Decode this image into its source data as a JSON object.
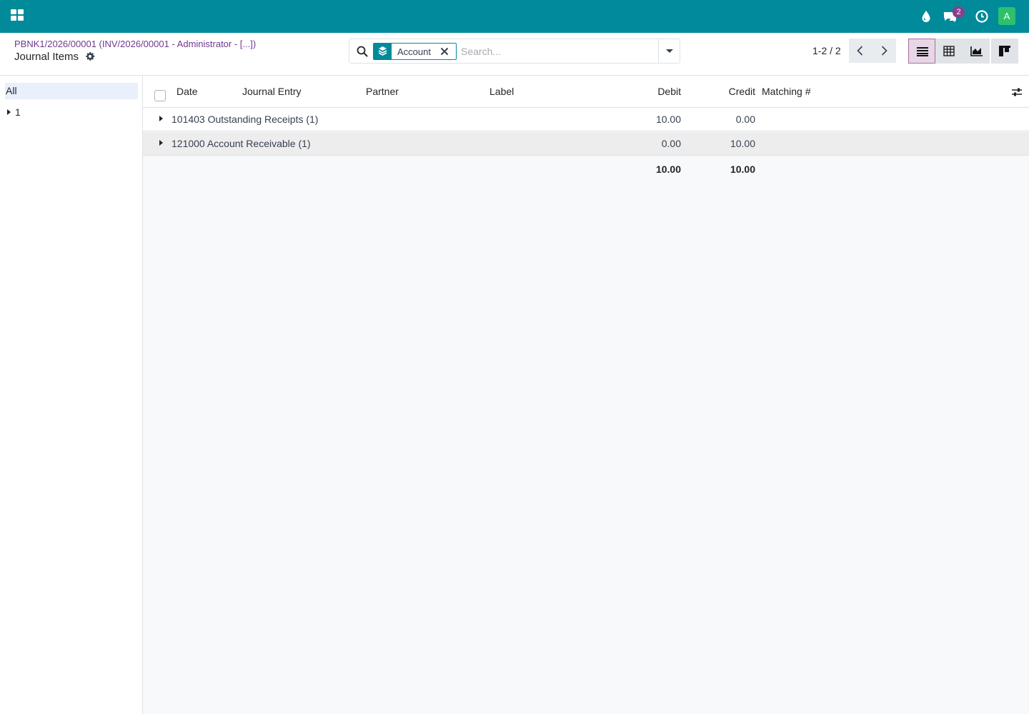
{
  "navbar": {
    "brand_color": "#018a9a",
    "icons": [
      "apps-icon",
      "water-drop-icon",
      "chat-icon",
      "clock-icon"
    ],
    "chat_count": "2",
    "avatar_letter": "A"
  },
  "control_panel": {
    "breadcrumb": "PBNK1/2026/00001 (INV/2026/00001 - Administrator - [...])",
    "title": "Journal Items",
    "search": {
      "facet_label": "Account",
      "placeholder": "Search..."
    },
    "pager": "1-2 / 2",
    "views": [
      "list",
      "pivot",
      "graph",
      "kanban"
    ],
    "active_view": "list"
  },
  "side_panel": {
    "all_label": "All",
    "items": [
      {
        "label": "1"
      }
    ]
  },
  "list": {
    "columns": [
      "Date",
      "Journal Entry",
      "Partner",
      "Label",
      "Debit",
      "Credit",
      "Matching #"
    ],
    "groups": [
      {
        "label": "101403 Outstanding Receipts (1)",
        "debit": "10.00",
        "credit": "0.00"
      },
      {
        "label": "121000 Account Receivable (1)",
        "debit": "0.00",
        "credit": "10.00"
      }
    ],
    "totals": {
      "debit": "10.00",
      "credit": "10.00"
    }
  }
}
